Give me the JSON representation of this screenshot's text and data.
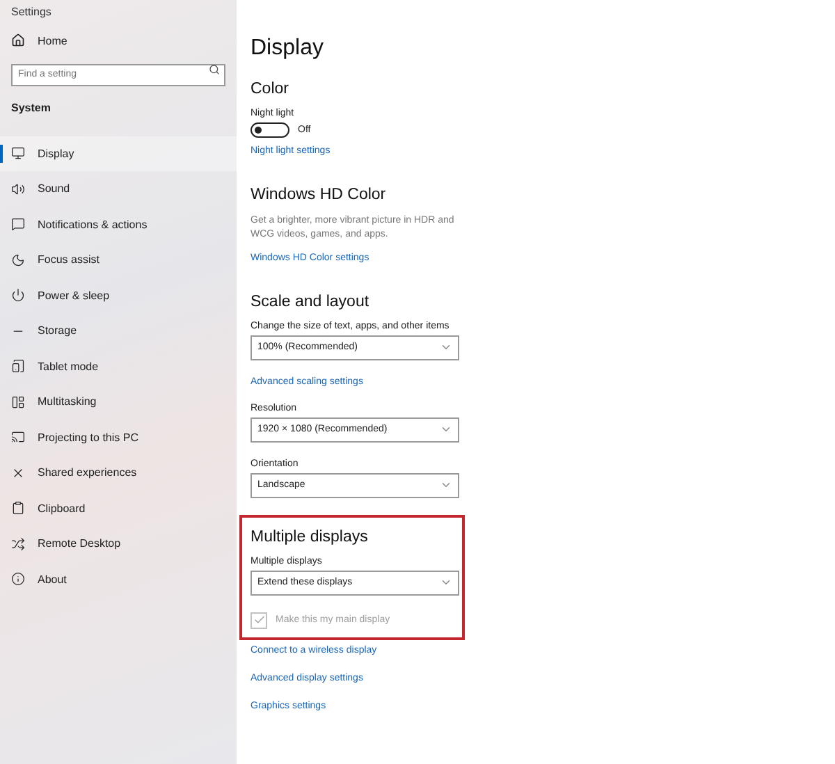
{
  "window": {
    "title": "Settings"
  },
  "sidebar": {
    "home": "Home",
    "search": {
      "placeholder": "Find a setting"
    },
    "group": "System",
    "items": [
      {
        "label": "Display",
        "selected": true
      },
      {
        "label": "Sound",
        "selected": false
      },
      {
        "label": "Notifications & actions",
        "selected": false
      },
      {
        "label": "Focus assist",
        "selected": false
      },
      {
        "label": "Power & sleep",
        "selected": false
      },
      {
        "label": "Storage",
        "selected": false
      },
      {
        "label": "Tablet mode",
        "selected": false
      },
      {
        "label": "Multitasking",
        "selected": false
      },
      {
        "label": "Projecting to this PC",
        "selected": false
      },
      {
        "label": "Shared experiences",
        "selected": false
      },
      {
        "label": "Clipboard",
        "selected": false
      },
      {
        "label": "Remote Desktop",
        "selected": false
      },
      {
        "label": "About",
        "selected": false
      }
    ]
  },
  "page": {
    "title": "Display",
    "sections": [
      {
        "heading": "Color",
        "highlighted": false,
        "controls": [
          {
            "kind": "toggle",
            "label": "Night light",
            "on": false,
            "state_text": "Off"
          },
          {
            "kind": "link",
            "text": "Night light settings"
          }
        ]
      },
      {
        "heading": "Windows HD Color",
        "highlighted": false,
        "controls": [
          {
            "kind": "text",
            "text": "Get a brighter, more vibrant picture in HDR and WCG videos, games, and apps."
          },
          {
            "kind": "link",
            "text": "Windows HD Color settings"
          }
        ]
      },
      {
        "heading": "Scale and layout",
        "highlighted": false,
        "controls": [
          {
            "kind": "dropdown",
            "label": "Change the size of text, apps, and other items",
            "value": "100% (Recommended)"
          },
          {
            "kind": "link",
            "text": "Advanced scaling settings"
          },
          {
            "kind": "dropdown",
            "label": "Resolution",
            "value": "1920 × 1080 (Recommended)"
          },
          {
            "kind": "dropdown",
            "label": "Orientation",
            "value": "Landscape"
          }
        ]
      },
      {
        "heading": "Multiple displays",
        "highlighted": true,
        "controls": [
          {
            "kind": "dropdown",
            "label": "Multiple displays",
            "value": "Extend these displays"
          },
          {
            "kind": "checkbox",
            "label": "Make this my main display",
            "checked": true,
            "disabled": true
          }
        ]
      }
    ],
    "links": [
      "Connect to a wireless display",
      "Advanced display settings",
      "Graphics settings"
    ]
  }
}
